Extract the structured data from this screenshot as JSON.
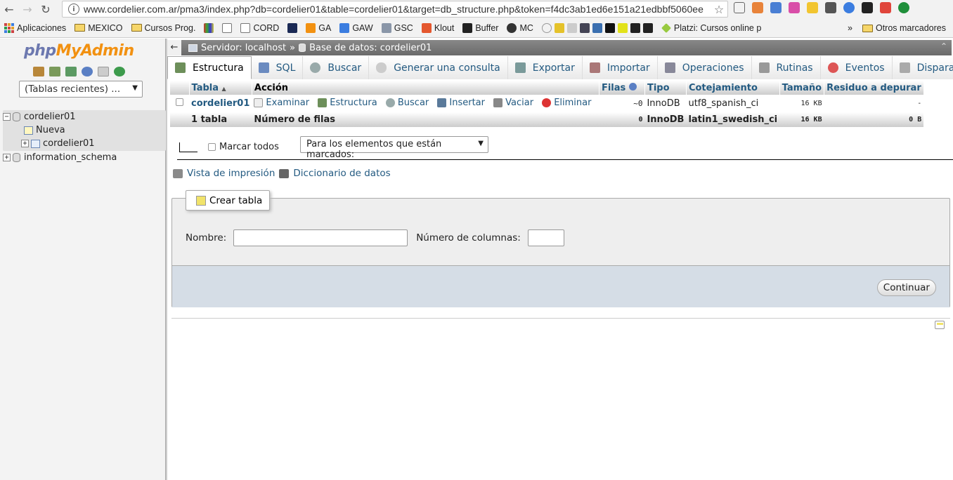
{
  "browser": {
    "url": "www.cordelier.com.ar/pma3/index.php?db=cordelier01&table=cordelier01&target=db_structure.php&token=f4dc3ab1ed6e151a21edbbf5060ee",
    "bookmarks": [
      {
        "label": "Aplicaciones",
        "icon": "apps-grid-icon"
      },
      {
        "label": "MEXICO",
        "icon": "folder-icon"
      },
      {
        "label": "Cursos Prog.",
        "icon": "folder-icon"
      },
      {
        "label": "",
        "icon": "bookmark-icon"
      },
      {
        "label": "",
        "icon": "page-icon"
      },
      {
        "label": "CORD",
        "icon": "page-icon"
      },
      {
        "label": "",
        "icon": "star-icon"
      },
      {
        "label": "GA",
        "icon": "analytics-icon"
      },
      {
        "label": "GAW",
        "icon": "adwords-icon"
      },
      {
        "label": "GSC",
        "icon": "search-console-icon"
      },
      {
        "label": "Klout",
        "icon": "klout-icon"
      },
      {
        "label": "Buffer",
        "icon": "buffer-icon"
      },
      {
        "label": "MC",
        "icon": "mailchimp-icon"
      }
    ],
    "bookmarks_extra": "Platzi: Cursos online p",
    "more_bookmarks": "»",
    "other_bookmarks": "Otros marcadores"
  },
  "nav": {
    "logo_php": "php",
    "logo_myadmin": "MyAdmin",
    "recent_tables": "(Tablas recientes) ...",
    "tree": {
      "db1": "cordelier01",
      "new_table": "Nueva",
      "table1": "cordelier01",
      "db2": "information_schema"
    }
  },
  "main": {
    "breadcrumb": {
      "server": "Servidor: localhost",
      "separator": "»",
      "database": "Base de datos: cordelier01"
    },
    "tabs": [
      {
        "label": "Estructura",
        "active": true
      },
      {
        "label": "SQL"
      },
      {
        "label": "Buscar"
      },
      {
        "label": "Generar una consulta"
      },
      {
        "label": "Exportar"
      },
      {
        "label": "Importar"
      },
      {
        "label": "Operaciones"
      },
      {
        "label": "Rutinas"
      },
      {
        "label": "Eventos"
      },
      {
        "label": "Disparadores"
      }
    ],
    "table": {
      "headers": {
        "tabla": "Tabla",
        "accion": "Acción",
        "filas": "Filas",
        "tipo": "Tipo",
        "cotejamiento": "Cotejamiento",
        "tamano": "Tamaño",
        "residuo": "Residuo a depurar"
      },
      "row": {
        "name": "cordelier01",
        "actions": [
          "Examinar",
          "Estructura",
          "Buscar",
          "Insertar",
          "Vaciar",
          "Eliminar"
        ],
        "rows": "~0",
        "type": "InnoDB",
        "collation": "utf8_spanish_ci",
        "size": "16 KB",
        "overhead": "-"
      },
      "summary": {
        "count": "1 tabla",
        "label": "Número de filas",
        "rows": "0",
        "type": "InnoDB",
        "collation": "latin1_swedish_ci",
        "size": "16 KB",
        "overhead": "0 B"
      }
    },
    "bulk": {
      "check_all": "Marcar todos",
      "with_selected": "Para los elementos que están marcados:"
    },
    "links": {
      "print_view": "Vista de impresión",
      "data_dictionary": "Diccionario de datos"
    },
    "create_table": {
      "legend": "Crear tabla",
      "name_label": "Nombre:",
      "name_value": "",
      "columns_label": "Número de columnas:",
      "columns_value": "",
      "submit": "Continuar"
    }
  },
  "colors": {
    "link": "#235a81",
    "logo_php": "#6c78af",
    "logo_myadmin": "#f29111",
    "footer_bg": "#d5dde6"
  }
}
